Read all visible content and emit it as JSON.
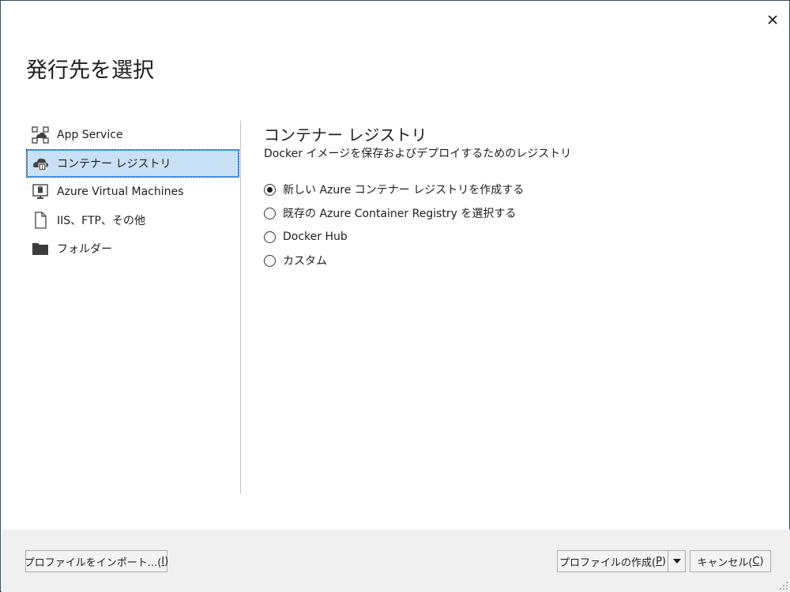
{
  "dialog": {
    "title": "発行先を選択",
    "close_icon": "close-icon"
  },
  "nav": {
    "items": [
      {
        "label": "App Service",
        "icon": "app-service-icon",
        "selected": false
      },
      {
        "label": "コンテナー レジストリ",
        "icon": "container-registry-icon",
        "selected": true
      },
      {
        "label": "Azure Virtual Machines",
        "icon": "virtual-machine-icon",
        "selected": false
      },
      {
        "label": "IIS、FTP、その他",
        "icon": "file-icon",
        "selected": false
      },
      {
        "label": "フォルダー",
        "icon": "folder-icon",
        "selected": false
      }
    ]
  },
  "content": {
    "heading": "コンテナー レジストリ",
    "description": "Docker イメージを保存およびデプロイするためのレジストリ",
    "options": [
      {
        "label": "新しい Azure コンテナー レジストリを作成する",
        "checked": true
      },
      {
        "label": "既存の Azure Container Registry を選択する",
        "checked": false
      },
      {
        "label": "Docker Hub",
        "checked": false
      },
      {
        "label": "カスタム",
        "checked": false
      }
    ]
  },
  "footer": {
    "import_label": "プロファイルをインポート...(",
    "import_key": "I",
    "import_end": ")",
    "create_label": "プロファイルの作成(",
    "create_key": "P",
    "create_end": ")",
    "cancel_label": "キャンセル(",
    "cancel_key": "C",
    "cancel_end": ")"
  }
}
